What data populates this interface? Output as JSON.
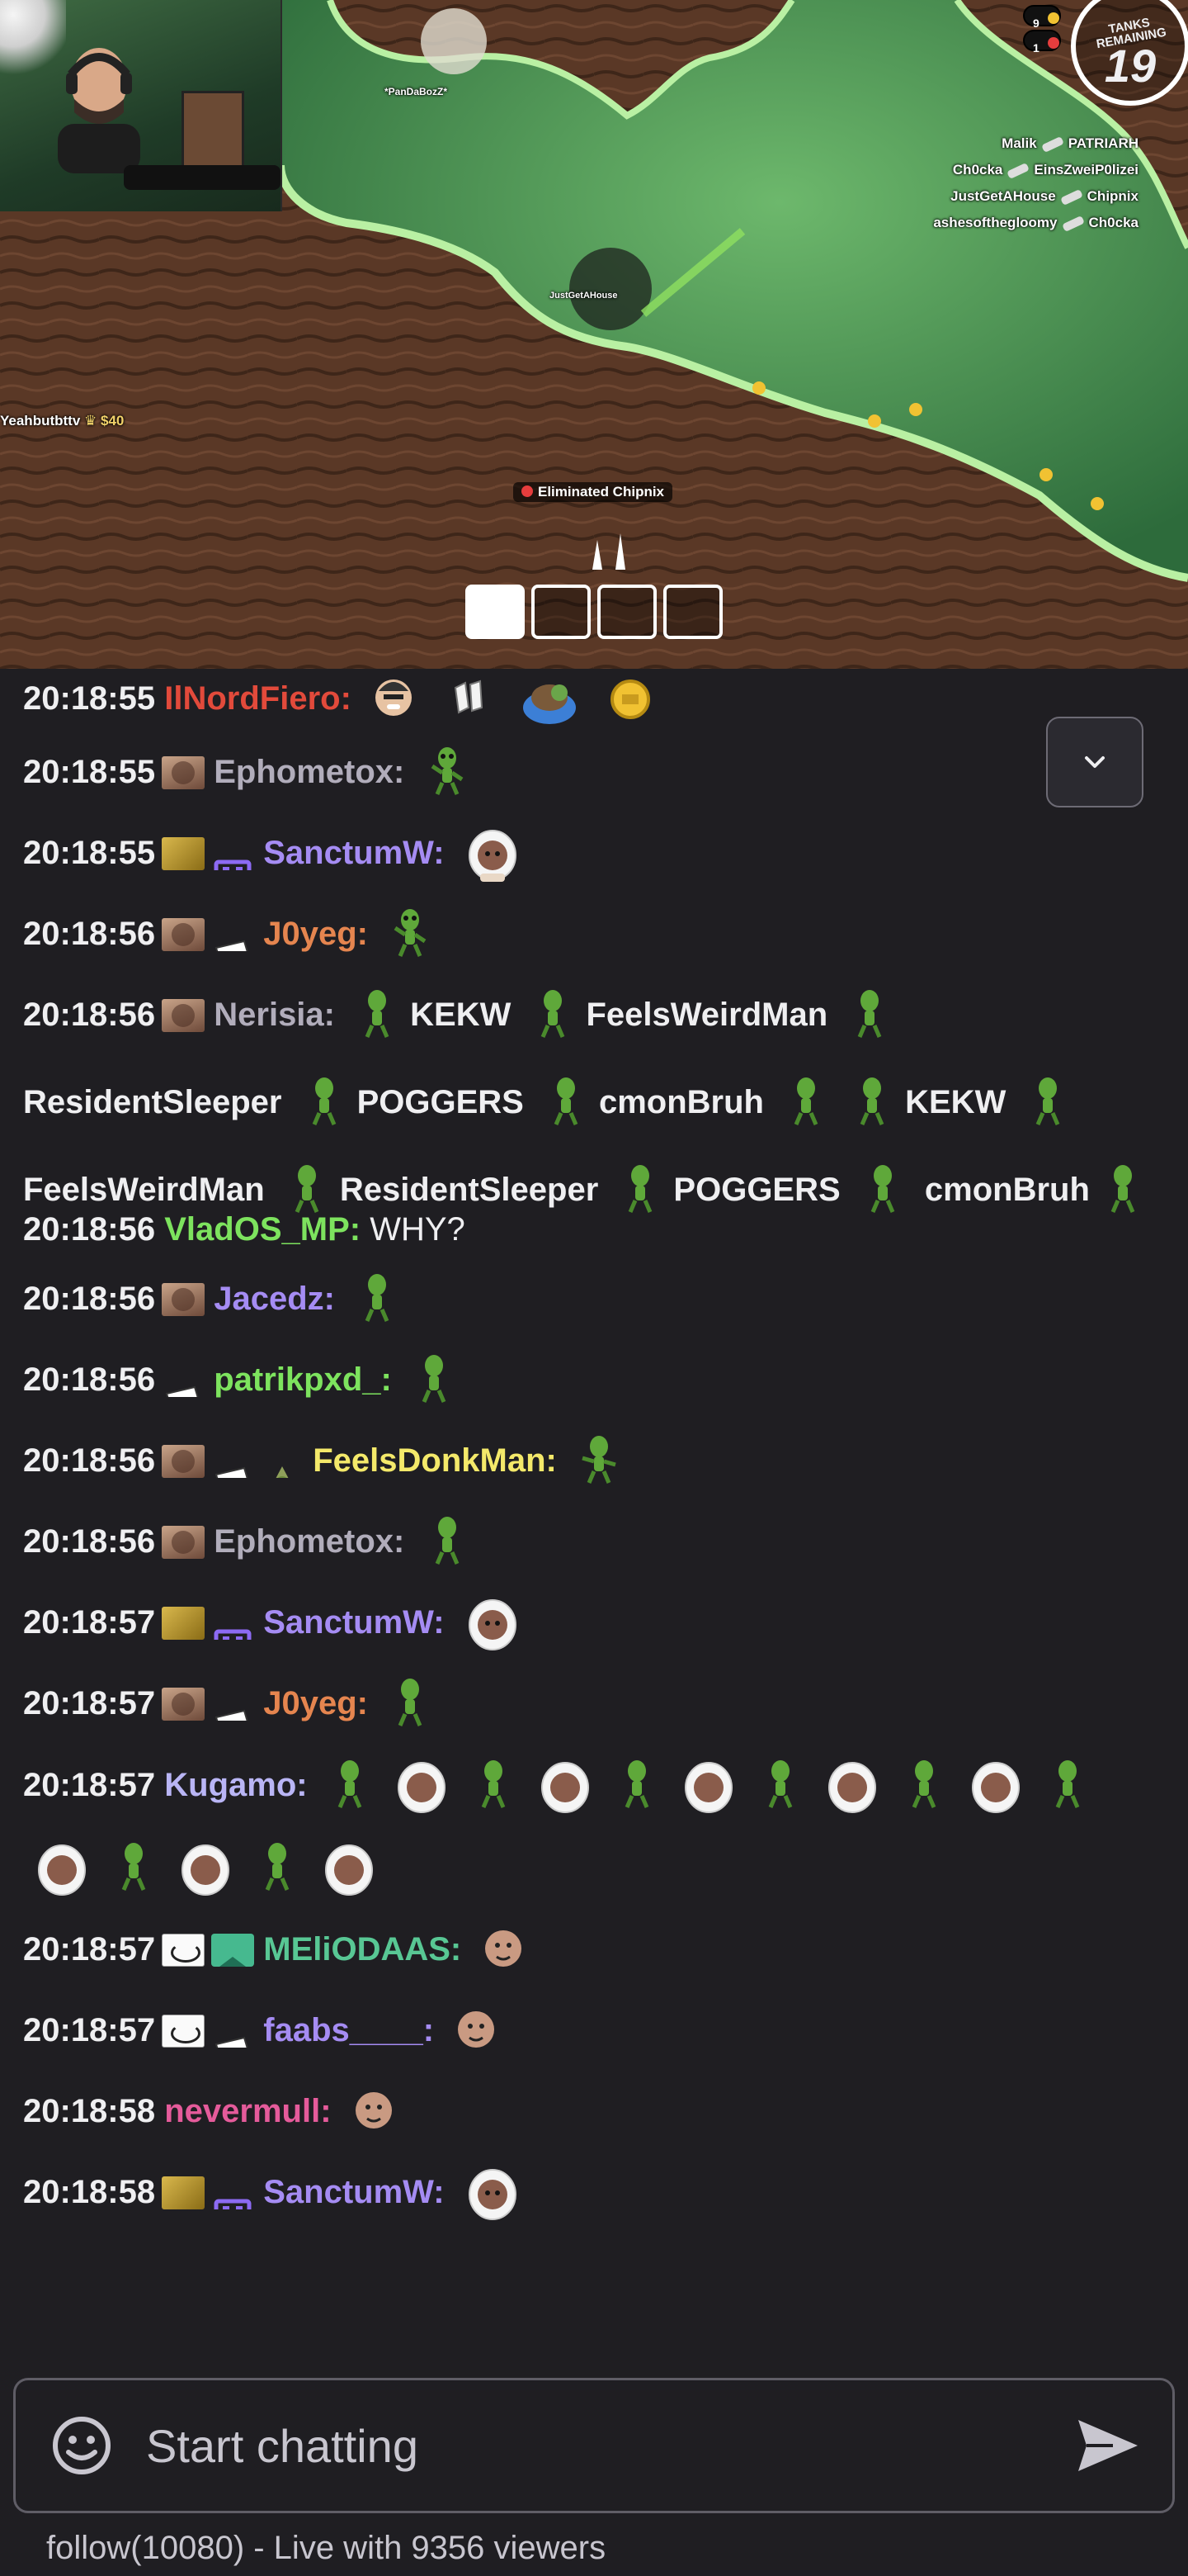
{
  "stream": {
    "tanks_remaining_label": "TANKS REMAINING",
    "tanks_remaining": "19",
    "coin_counts": [
      "9",
      "1"
    ],
    "player_tags": [
      "*PanDaBozZ*",
      "JustGetAHouse"
    ],
    "killfeed": [
      {
        "killer": "Malik",
        "victim": "PATRIARH"
      },
      {
        "killer": "Ch0cka",
        "victim": "EinsZweiP0lizei"
      },
      {
        "killer": "JustGetAHouse",
        "victim": "Chipnix"
      },
      {
        "killer": "ashesofthegloomy",
        "victim": "Ch0cka"
      }
    ],
    "eliminated": "Eliminated Chipnix",
    "donation_user": "Yeahbutbttv",
    "donation_amount": "$40"
  },
  "chat": {
    "messages": [
      {
        "time": "20:18:55",
        "user": "IlNordFiero:",
        "color": "#e24a3b"
      },
      {
        "time": "20:18:55",
        "user": "Ephometox:",
        "color": "#b1adbb"
      },
      {
        "time": "20:18:55",
        "user": "SanctumW:",
        "color": "#a58cf3"
      },
      {
        "time": "20:18:56",
        "user": "J0yeg:",
        "color": "#e5854f"
      },
      {
        "time": "20:18:56",
        "user": "Nerisia:",
        "color": "#b1adbb",
        "words": [
          "KEKW",
          "FeelsWeirdMan",
          "ResidentSleeper",
          "POGGERS",
          "cmonBruh",
          "KEKW",
          "FeelsWeirdMan",
          "ResidentSleeper",
          "POGGERS",
          "cmonBruh"
        ]
      },
      {
        "time": "20:18:56",
        "user": "VladOS_MP:",
        "color": "#7de35e",
        "text": "WHY?"
      },
      {
        "time": "20:18:56",
        "user": "Jacedz:",
        "color": "#a58cf3"
      },
      {
        "time": "20:18:56",
        "user": "patrikpxd_:",
        "color": "#7de35e"
      },
      {
        "time": "20:18:56",
        "user": "FeelsDonkMan:",
        "color": "#f4e96a"
      },
      {
        "time": "20:18:56",
        "user": "Ephometox:",
        "color": "#b1adbb"
      },
      {
        "time": "20:18:57",
        "user": "SanctumW:",
        "color": "#a58cf3"
      },
      {
        "time": "20:18:57",
        "user": "J0yeg:",
        "color": "#e5854f"
      },
      {
        "time": "20:18:57",
        "user": "Kugamo:",
        "color": "#b9b5f5"
      },
      {
        "time": "20:18:57",
        "user": "MEliODAAS:",
        "color": "#58c794"
      },
      {
        "time": "20:18:57",
        "user": "faabs____:",
        "color": "#a58cf3"
      },
      {
        "time": "20:18:58",
        "user": "nevermull:",
        "color": "#e55b9b"
      },
      {
        "time": "20:18:58",
        "user": "SanctumW:",
        "color": "#a58cf3"
      }
    ]
  },
  "input": {
    "placeholder": "Start chatting",
    "status": "follow(10080) - Live with 9356 viewers"
  }
}
